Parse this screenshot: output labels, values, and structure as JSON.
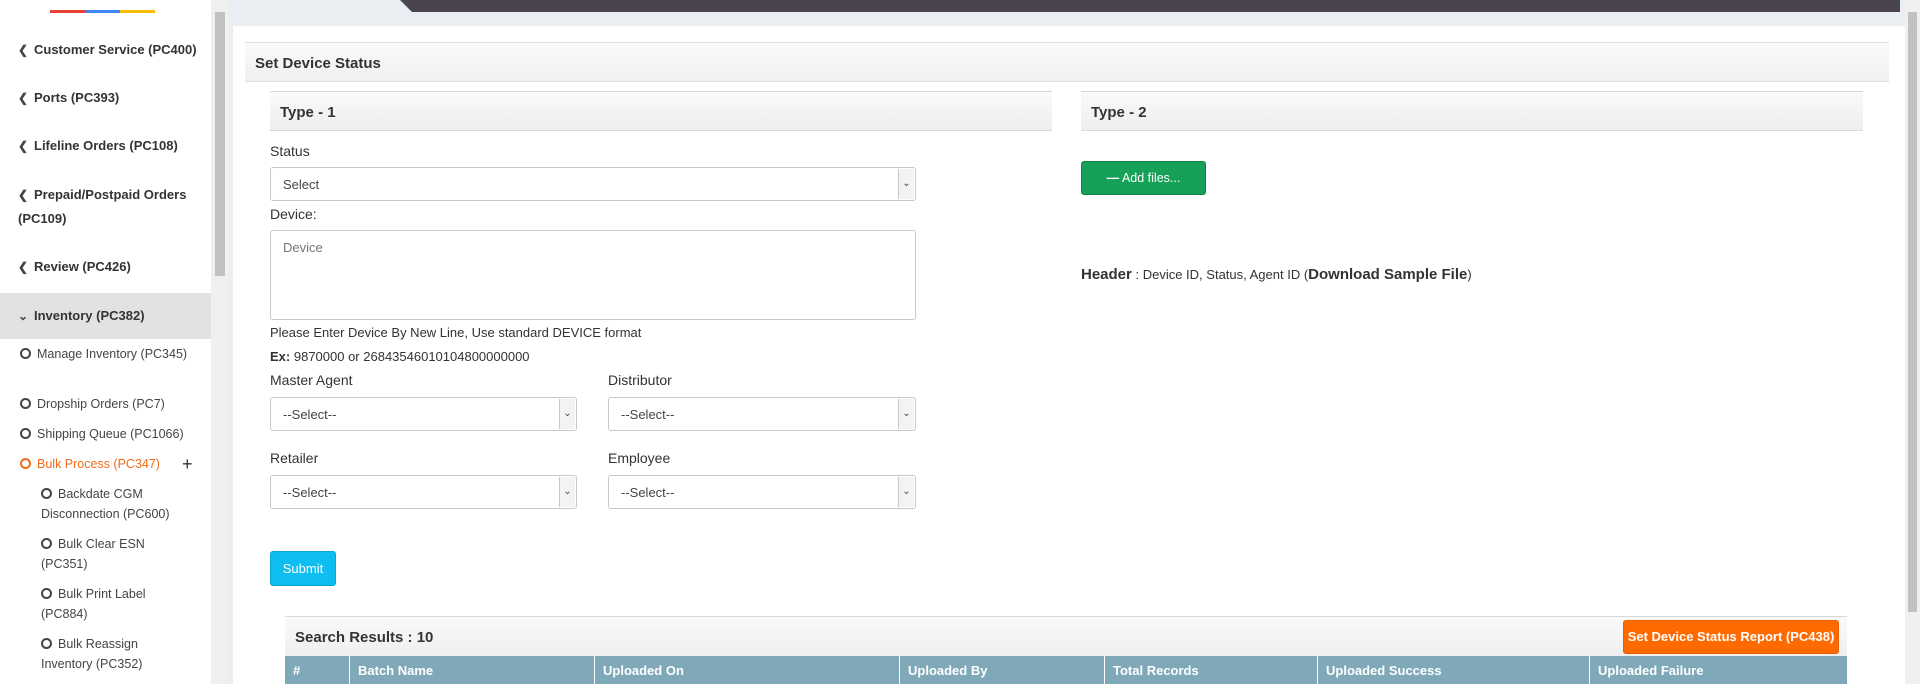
{
  "sidebar": {
    "items": [
      {
        "label": "Customer Service (PC400)"
      },
      {
        "label": "Ports (PC393)"
      },
      {
        "label": "Lifeline Orders (PC108)"
      },
      {
        "label": "Prepaid/Postpaid Orders (PC109)"
      },
      {
        "label": "Review (PC426)"
      },
      {
        "label": "Inventory (PC382)"
      }
    ],
    "sub_items": [
      {
        "label": "Manage Inventory (PC345)"
      },
      {
        "label": "Dropship Orders (PC7)"
      },
      {
        "label": "Shipping Queue (PC1066)"
      },
      {
        "label": "Bulk Process (PC347)"
      }
    ],
    "sub_sub_items": [
      {
        "label": "Backdate CGM Disconnection (PC600)"
      },
      {
        "label": "Bulk Clear ESN (PC351)"
      },
      {
        "label": "Bulk Print Label (PC884)"
      },
      {
        "label": "Bulk Reassign Inventory (PC352)"
      }
    ],
    "expand_icon": "plus-icon",
    "collapse_icon": "chevron-left-icon",
    "expanded_icon": "chevron-down-icon"
  },
  "page": {
    "title": "Set Device Status"
  },
  "type1": {
    "heading": "Type - 1",
    "status_label": "Status",
    "status_value": "Select",
    "device_label": "Device:",
    "device_placeholder": "Device",
    "help_line1": "Please Enter Device By New Line, Use standard DEVICE format",
    "help_ex_label": "Ex:",
    "help_ex_value": "9870000 or 26843546010104800000000",
    "master_agent_label": "Master Agent",
    "master_agent_value": "--Select--",
    "distributor_label": "Distributor",
    "distributor_value": "--Select--",
    "retailer_label": "Retailer",
    "retailer_value": "--Select--",
    "employee_label": "Employee",
    "employee_value": "--Select--",
    "submit_label": "Submit"
  },
  "type2": {
    "heading": "Type - 2",
    "add_files_label": "Add files...",
    "header_label": "Header",
    "header_fields": ": Device ID, Status, Agent ID (",
    "download_label": "Download Sample File",
    "close_paren": ")"
  },
  "results": {
    "title": "Search Results : 10",
    "report_button": "Set Device Status Report (PC438)",
    "columns": [
      "#",
      "Batch Name",
      "Uploaded On",
      "Uploaded By",
      "Total Records",
      "Uploaded Success",
      "Uploaded Failure"
    ]
  },
  "colors": {
    "accent_orange": "#f06d1b",
    "add_files_green": "#16a058",
    "submit_cyan": "#0fbef0",
    "report_orange": "#ff6a00",
    "table_header": "#7fa9b8"
  }
}
